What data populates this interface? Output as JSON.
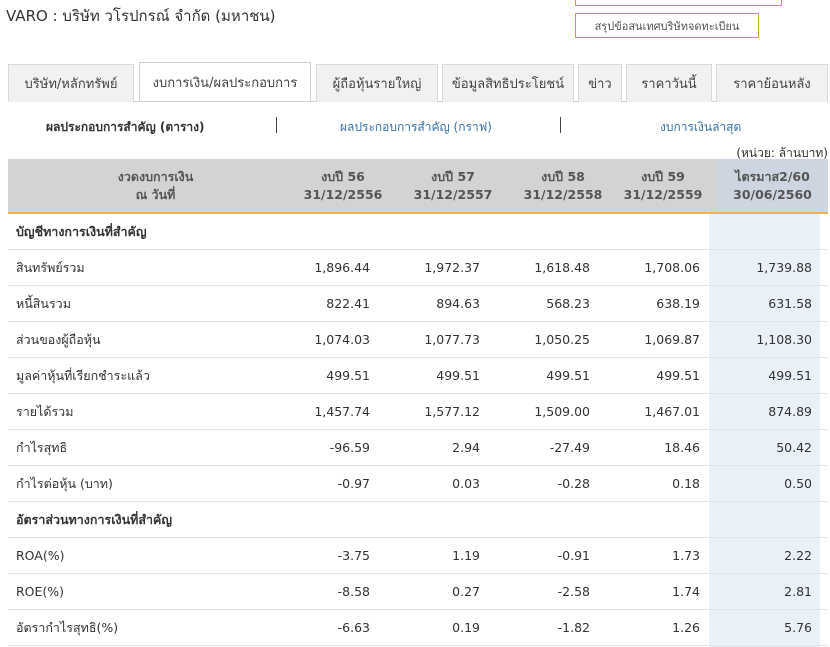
{
  "company_title": "VARO : บริษัท วโรปกรณ์ จำกัด (มหาชน)",
  "summary_button": "สรุปข้อสนเทศบริษัทจดทะเบียน",
  "tabs": [
    {
      "label": "บริษัท/หลักทรัพย์"
    },
    {
      "label": "งบการเงิน/ผลประกอบการ"
    },
    {
      "label": "ผู้ถือหุ้นรายใหญ่"
    },
    {
      "label": "ข้อมูลสิทธิประโยชน์"
    },
    {
      "label": "ข่าว"
    },
    {
      "label": "ราคาวันนี้"
    },
    {
      "label": "ราคาย้อนหลัง"
    }
  ],
  "subnav": [
    {
      "label": "ผลประกอบการสำคัญ (ตาราง)"
    },
    {
      "label": "ผลประกอบการสำคัญ (กราฟ)"
    },
    {
      "label": "งบการเงินล่าสุด"
    }
  ],
  "unit_note": "(หน่วย: ล้านบาท)",
  "table": {
    "header_label": [
      "งวดงบการเงิน",
      "ณ วันที่"
    ],
    "columns": [
      {
        "l1": "งบปี 56",
        "l2": "31/12/2556"
      },
      {
        "l1": "งบปี 57",
        "l2": "31/12/2557"
      },
      {
        "l1": "งบปี 58",
        "l2": "31/12/2558"
      },
      {
        "l1": "งบปี 59",
        "l2": "31/12/2559"
      },
      {
        "l1": "ไตรมาส2/60",
        "l2": "30/06/2560"
      }
    ],
    "rows": [
      {
        "label": "บัญชีทางการเงินที่สำคัญ",
        "section": true,
        "values": []
      },
      {
        "label": "สินทรัพย์รวม",
        "values": [
          "1,896.44",
          "1,972.37",
          "1,618.48",
          "1,708.06",
          "1,739.88"
        ]
      },
      {
        "label": "หนี้สินรวม",
        "values": [
          "822.41",
          "894.63",
          "568.23",
          "638.19",
          "631.58"
        ]
      },
      {
        "label": "ส่วนของผู้ถือหุ้น",
        "values": [
          "1,074.03",
          "1,077.73",
          "1,050.25",
          "1,069.87",
          "1,108.30"
        ]
      },
      {
        "label": "มูลค่าหุ้นที่เรียกชำระแล้ว",
        "values": [
          "499.51",
          "499.51",
          "499.51",
          "499.51",
          "499.51"
        ]
      },
      {
        "label": "รายได้รวม",
        "values": [
          "1,457.74",
          "1,577.12",
          "1,509.00",
          "1,467.01",
          "874.89"
        ]
      },
      {
        "label": "กำไรสุทธิ",
        "values": [
          "-96.59",
          "2.94",
          "-27.49",
          "18.46",
          "50.42"
        ]
      },
      {
        "label": "กำไรต่อหุ้น (บาท)",
        "values": [
          "-0.97",
          "0.03",
          "-0.28",
          "0.18",
          "0.50"
        ]
      },
      {
        "label": "อัตราส่วนทางการเงินที่สำคัญ",
        "section": true,
        "values": []
      },
      {
        "label": "ROA(%)",
        "values": [
          "-3.75",
          "1.19",
          "-0.91",
          "1.73",
          "2.22"
        ]
      },
      {
        "label": "ROE(%)",
        "values": [
          "-8.58",
          "0.27",
          "-2.58",
          "1.74",
          "2.81"
        ]
      },
      {
        "label": "อัตรากำไรสุทธิ(%)",
        "values": [
          "-6.63",
          "0.19",
          "-1.82",
          "1.26",
          "5.76"
        ]
      }
    ]
  }
}
